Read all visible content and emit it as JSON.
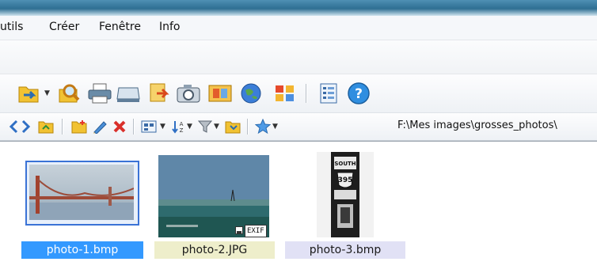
{
  "menu": {
    "items": [
      "utils",
      "Créer",
      "Fenêtre",
      "Info"
    ]
  },
  "toolbar1": {
    "icons": [
      "folder-dropdown-icon",
      "search-folder-icon",
      "printer-icon",
      "scanner-icon",
      "export-icon",
      "camera-icon",
      "slideshow-icon",
      "web-globe-icon",
      "thumbnail-grid-icon",
      "list-view-icon",
      "help-icon"
    ]
  },
  "toolbar2": {
    "path": "F:\\Mes images\\grosses_photos\\"
  },
  "files": [
    {
      "name": "photo-1.bmp",
      "selected": true,
      "caption_bg": "#3399ff",
      "caption_color": "#ffffff"
    },
    {
      "name": "photo-2.JPG",
      "selected": false,
      "caption_bg": "#eeeecb",
      "caption_color": "#1a1a1a",
      "badge": "EXIF"
    },
    {
      "name": "photo-3.bmp",
      "selected": false,
      "caption_bg": "#e1e1f5",
      "caption_color": "#1a1a1a"
    }
  ],
  "colors": {
    "accent": "#3399ff",
    "titlebar": "#2e6e92"
  }
}
